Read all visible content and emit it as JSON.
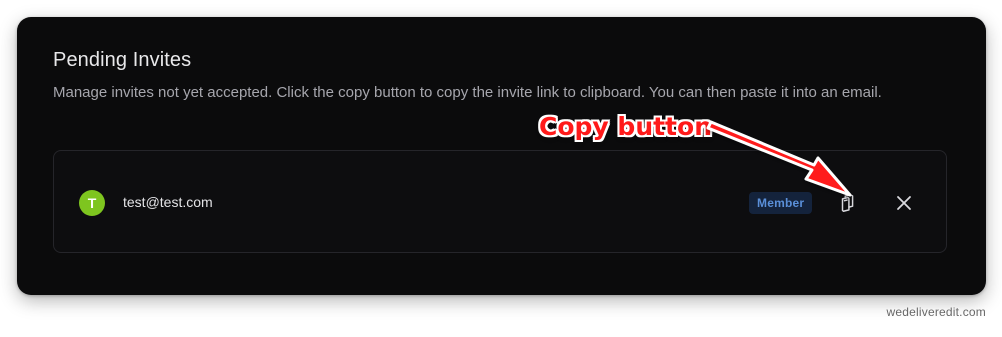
{
  "panel": {
    "title": "Pending Invites",
    "description": "Manage invites not yet accepted. Click the copy button to copy the invite link to clipboard. You can then paste it into an email."
  },
  "invites": [
    {
      "avatar_initial": "T",
      "avatar_color": "#7ec51f",
      "email": "test@test.com",
      "role": "Member",
      "copy_icon": "clipboard-copy-icon",
      "remove_icon": "close-icon"
    }
  ],
  "annotation": {
    "label": "Copy button",
    "color": "#ff1a1a"
  },
  "watermark": "wedeliveredit.com"
}
